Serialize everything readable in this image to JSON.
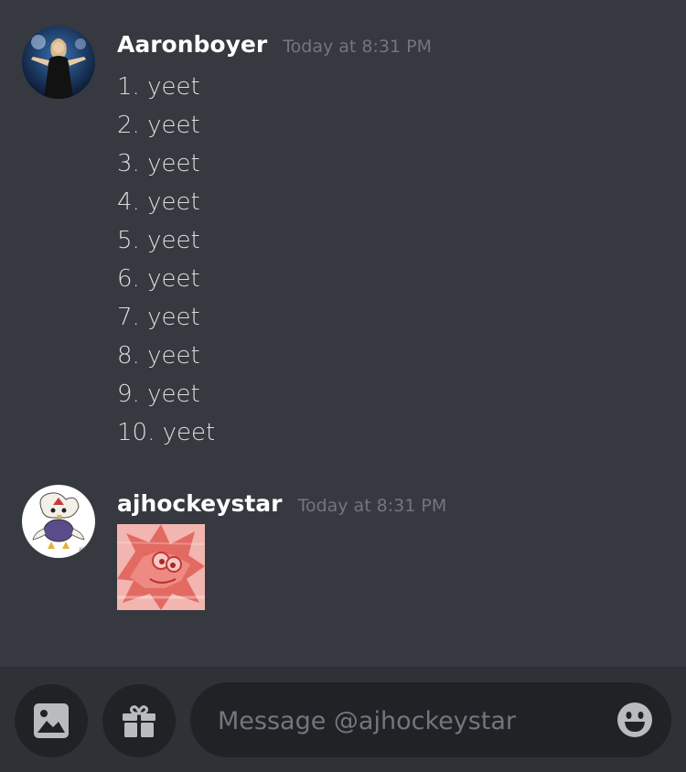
{
  "messages": [
    {
      "username": "Aaronboyer",
      "timestamp": "Today at 8:31 PM",
      "lines": [
        "1. yeet",
        "2. yeet",
        "3. yeet",
        "4. yeet",
        "5. yeet",
        "6. yeet",
        "7. yeet",
        "8. yeet",
        "9. yeet",
        "10. yeet"
      ]
    },
    {
      "username": "ajhockeystar",
      "timestamp": "Today at 8:31 PM",
      "attachment": "image"
    }
  ],
  "composer": {
    "placeholder": "Message @ajhockeystar",
    "buttons": [
      "image-icon",
      "gift-icon",
      "emoji-icon"
    ]
  },
  "colors": {
    "background": "#36393f",
    "bar": "#2f3136",
    "input": "#202225",
    "username": "#ffffff",
    "timestamp": "#72767d",
    "text": "#dcddde"
  }
}
